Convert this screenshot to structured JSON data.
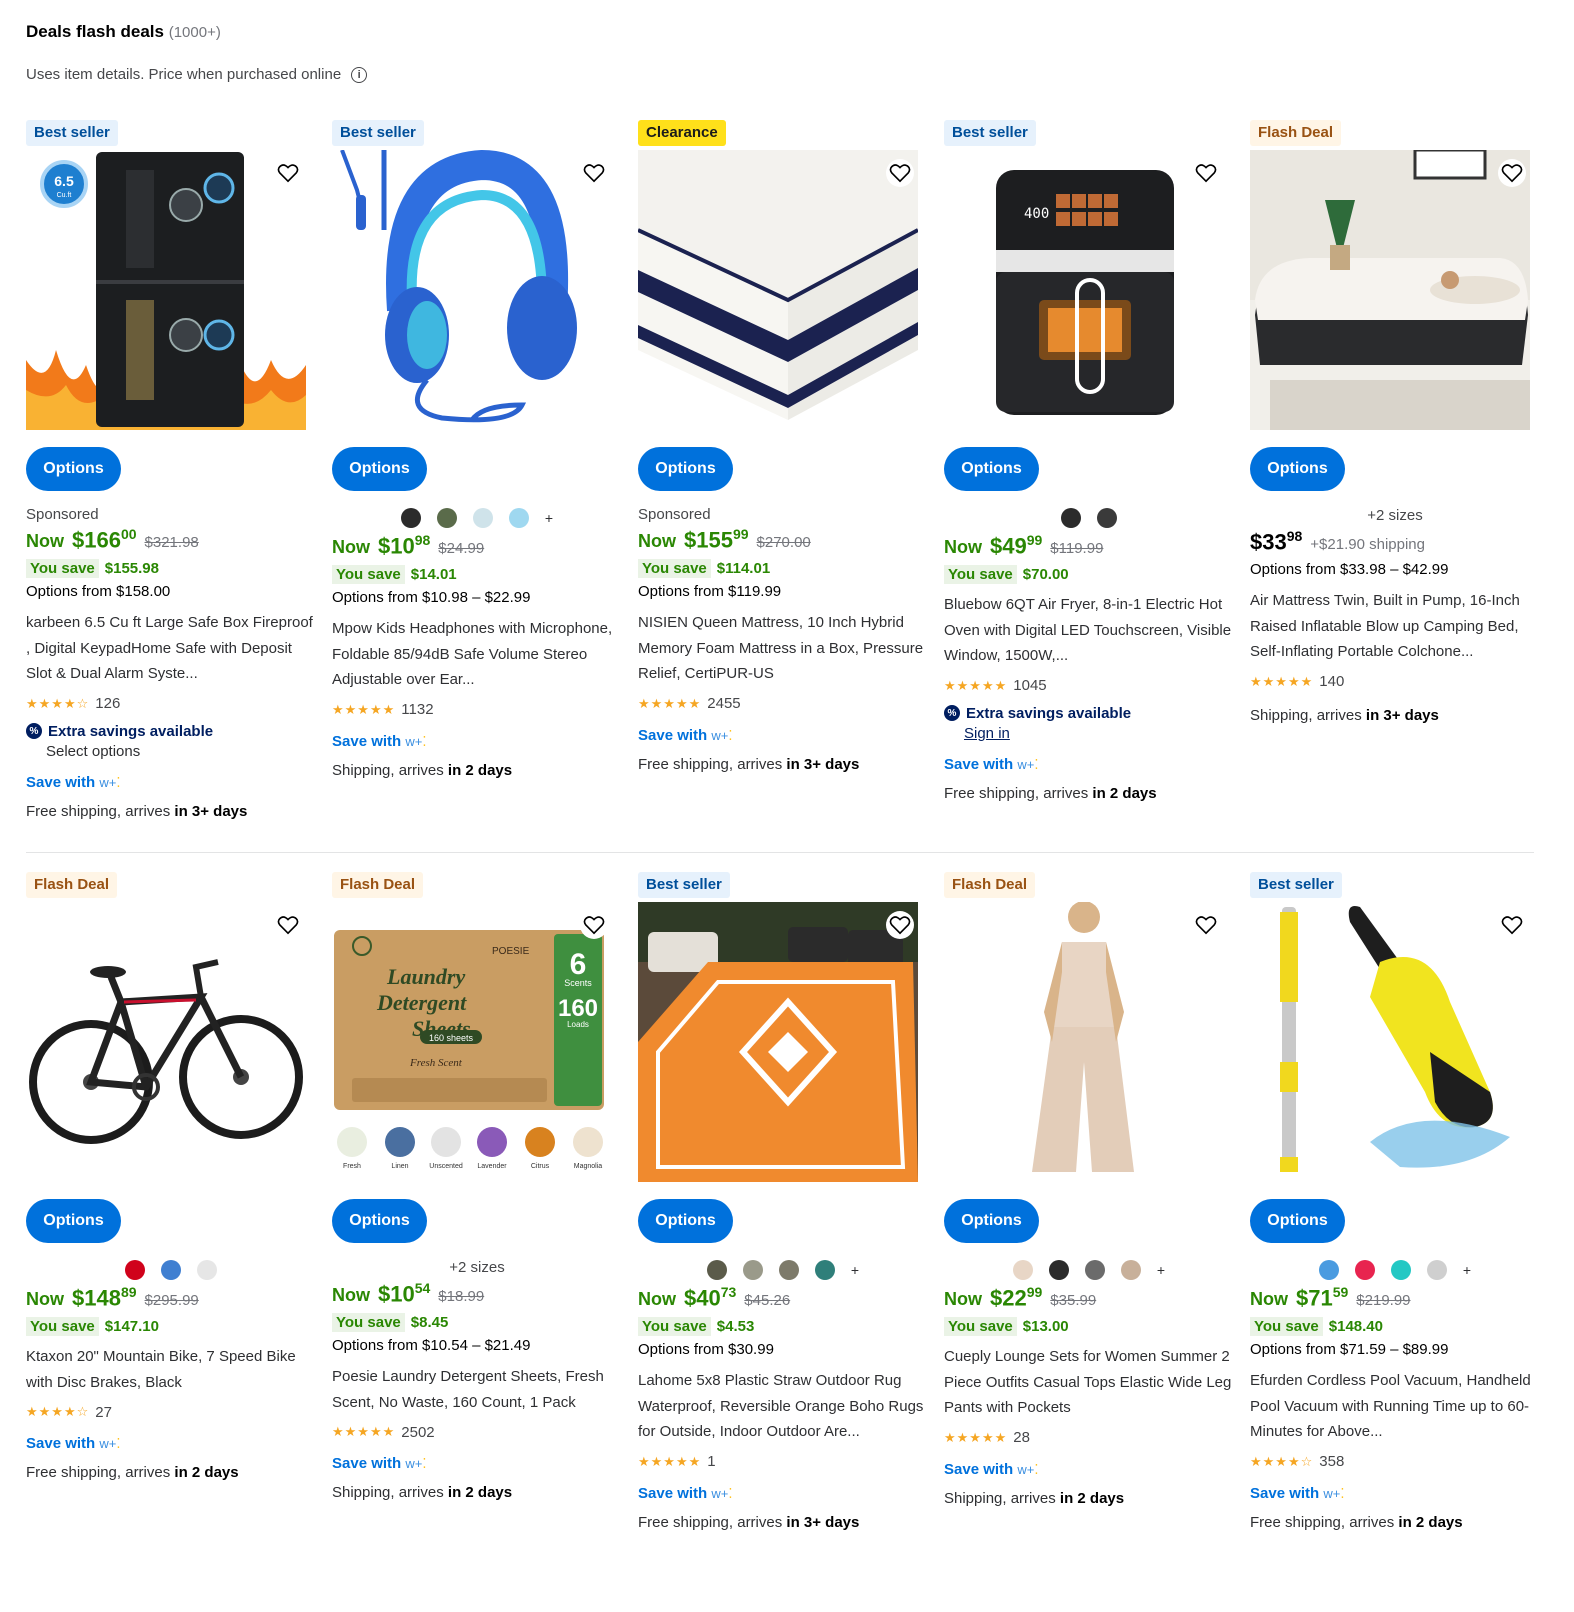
{
  "header": {
    "title": "Deals flash deals",
    "count": "(1000+)",
    "subtitle": "Uses item details. Price when purchased online"
  },
  "labels": {
    "options": "Options",
    "now": "Now",
    "you_save": "You save",
    "save_with": "Save with",
    "wplus": "w+",
    "extra_savings": "Extra savings available"
  },
  "products": [
    {
      "badge": "Best seller",
      "badge_type": "best",
      "sponsored": "Sponsored",
      "swatches": [],
      "swatch_more": "",
      "sizes": "",
      "price_prefix": "Now",
      "dollars": "$166",
      "cents": "00",
      "was": "$321.98",
      "you_save": "$155.98",
      "options_from": "Options from $158.00",
      "name": "karbeen 6.5 Cu ft Large Safe Box Fireproof , Digital KeypadHome Safe with Deposit Slot & Dual Alarm Syste...",
      "stars": "★★★★☆",
      "rating": 3.5,
      "reviews": "126",
      "extra_savings": true,
      "extra_sub": "Select options",
      "extra_sub_link": false,
      "ship_prefix": "Free shipping, arrives ",
      "ship_bold": "in 3+ days",
      "image": "safe"
    },
    {
      "badge": "Best seller",
      "badge_type": "best",
      "sponsored": "",
      "swatches": [
        "#2b2b2b",
        "#5a6b4a",
        "#cfe3ea",
        "#9fd8f0"
      ],
      "swatch_more": "+",
      "sizes": "",
      "price_prefix": "Now",
      "dollars": "$10",
      "cents": "98",
      "was": "$24.99",
      "you_save": "$14.01",
      "options_from": "Options from $10.98 – $22.99",
      "name": "Mpow Kids Headphones with Microphone, Foldable 85/94dB Safe Volume Stereo Adjustable over Ear...",
      "stars": "★★★★★",
      "rating": 4.5,
      "reviews": "1132",
      "extra_savings": false,
      "extra_sub": "",
      "extra_sub_link": false,
      "ship_prefix": "Shipping, arrives ",
      "ship_bold": "in 2 days",
      "image": "headphones"
    },
    {
      "badge": "Clearance",
      "badge_type": "clear",
      "sponsored": "Sponsored",
      "swatches": [],
      "swatch_more": "",
      "sizes": "",
      "price_prefix": "Now",
      "dollars": "$155",
      "cents": "99",
      "was": "$270.00",
      "you_save": "$114.01",
      "options_from": "Options from $119.99",
      "name": "NISIEN Queen Mattress, 10 Inch Hybrid Memory Foam Mattress in a Box, Pressure Relief, CertiPUR-US",
      "stars": "★★★★★",
      "rating": 4.5,
      "reviews": "2455",
      "extra_savings": false,
      "extra_sub": "",
      "extra_sub_link": false,
      "ship_prefix": "Free shipping, arrives ",
      "ship_bold": "in 3+ days",
      "image": "mattress"
    },
    {
      "badge": "Best seller",
      "badge_type": "best",
      "sponsored": "",
      "swatches": [
        "#2b2b2b",
        "#3a3a3a"
      ],
      "swatch_more": "",
      "sizes": "",
      "price_prefix": "Now",
      "dollars": "$49",
      "cents": "99",
      "was": "$119.99",
      "you_save": "$70.00",
      "options_from": "",
      "name": "Bluebow 6QT Air Fryer, 8-in-1 Electric Hot Oven with Digital LED Touchscreen, Visible Window, 1500W,...",
      "stars": "★★★★★",
      "rating": 4.5,
      "reviews": "1045",
      "extra_savings": true,
      "extra_sub": "Sign in",
      "extra_sub_link": true,
      "ship_prefix": "Free shipping, arrives ",
      "ship_bold": "in 2 days",
      "image": "airfryer"
    },
    {
      "badge": "Flash Deal",
      "badge_type": "flash",
      "sponsored": "",
      "swatches": [],
      "swatch_more": "",
      "sizes": "+2 sizes",
      "price_prefix": "",
      "dollars": "$33",
      "cents": "98",
      "was": "",
      "ship_extra": "+$21.90 shipping",
      "you_save": "",
      "options_from": "Options from $33.98 – $42.99",
      "name": "Air Mattress Twin, Built in Pump, 16-Inch Raised Inflatable Blow up Camping Bed, Self-Inflating Portable Colchone...",
      "stars": "★★★★★",
      "rating": 4.5,
      "reviews": "140",
      "extra_savings": false,
      "extra_sub": "",
      "extra_sub_link": false,
      "no_wplus": true,
      "ship_prefix": "Shipping, arrives ",
      "ship_bold": "in 3+ days",
      "image": "airbed"
    },
    {
      "badge": "Flash Deal",
      "badge_type": "flash",
      "sponsored": "",
      "swatches": [
        "#d0021b",
        "#3f7fd1",
        "#e6e6e6"
      ],
      "swatch_more": "",
      "sizes": "",
      "price_prefix": "Now",
      "dollars": "$148",
      "cents": "89",
      "was": "$295.99",
      "you_save": "$147.10",
      "options_from": "",
      "name": "Ktaxon 20\" Mountain Bike, 7 Speed Bike with Disc Brakes, Black",
      "stars": "★★★★☆",
      "rating": 4,
      "reviews": "27",
      "extra_savings": false,
      "extra_sub": "",
      "extra_sub_link": false,
      "ship_prefix": "Free shipping, arrives ",
      "ship_bold": "in 2 days",
      "image": "bike"
    },
    {
      "badge": "Flash Deal",
      "badge_type": "flash",
      "sponsored": "",
      "swatches": [],
      "swatch_more": "",
      "sizes": "+2 sizes",
      "price_prefix": "Now",
      "dollars": "$10",
      "cents": "54",
      "was": "$18.99",
      "you_save": "$8.45",
      "options_from": "Options from $10.54 – $21.49",
      "name": "Poesie Laundry Detergent Sheets, Fresh Scent, No Waste, 160 Count, 1 Pack",
      "stars": "★★★★★",
      "rating": 4.5,
      "reviews": "2502",
      "extra_savings": false,
      "extra_sub": "",
      "extra_sub_link": false,
      "ship_prefix": "Shipping, arrives ",
      "ship_bold": "in 2 days",
      "image": "laundry",
      "image_text": {
        "brand": "POESIE",
        "line1": "Laundry",
        "line2": "Detergent",
        "line3": "Sheets",
        "count": "160 sheets",
        "scent": "Fresh Scent",
        "badge_num": "6",
        "badge_scents": "Scents",
        "badge_count": "160",
        "badge_loads": "Loads",
        "variants": [
          "Fresh",
          "Linen",
          "Unscented",
          "Lavender",
          "Citrus",
          "Magnolia"
        ]
      }
    },
    {
      "badge": "Best seller",
      "badge_type": "best",
      "sponsored": "",
      "swatches": [
        "#5b5b4a",
        "#9a9a8a",
        "#7d7a6a",
        "#2f7f7a"
      ],
      "swatch_more": "+",
      "sizes": "",
      "price_prefix": "Now",
      "dollars": "$40",
      "cents": "73",
      "was": "$45.26",
      "you_save": "$4.53",
      "options_from": "Options from $30.99",
      "name": "Lahome 5x8 Plastic Straw Outdoor Rug Waterproof, Reversible Orange Boho Rugs for Outside, Indoor Outdoor Are...",
      "stars": "★★★★★",
      "rating": 5,
      "reviews": "1",
      "extra_savings": false,
      "extra_sub": "",
      "extra_sub_link": false,
      "no_wplus": true,
      "ship_prefix": "Free shipping, arrives ",
      "ship_bold": "in 3+ days",
      "image": "rug"
    },
    {
      "badge": "Flash Deal",
      "badge_type": "flash",
      "sponsored": "",
      "swatches": [
        "#e8d6c6",
        "#2b2b2b",
        "#6b6b6b",
        "#c8b09a"
      ],
      "swatch_more": "+",
      "sizes": "",
      "price_prefix": "Now",
      "dollars": "$22",
      "cents": "99",
      "was": "$35.99",
      "you_save": "$13.00",
      "options_from": "",
      "name": "Cueply Lounge Sets for Women Summer 2 Piece Outfits Casual Tops Elastic Wide Leg Pants with Pockets",
      "stars": "★★★★★",
      "rating": 4.5,
      "reviews": "28",
      "extra_savings": false,
      "extra_sub": "",
      "extra_sub_link": false,
      "ship_prefix": "Shipping, arrives ",
      "ship_bold": "in 2 days",
      "image": "outfit"
    },
    {
      "badge": "Best seller",
      "badge_type": "best",
      "sponsored": "",
      "swatches": [
        "#4a9be0",
        "#e8244f",
        "#23c8c4",
        "#cfcfcf"
      ],
      "swatch_more": "+",
      "sizes": "",
      "price_prefix": "Now",
      "dollars": "$71",
      "cents": "59",
      "was": "$219.99",
      "you_save": "$148.40",
      "options_from": "Options from $71.59 – $89.99",
      "name": "Efurden Cordless Pool Vacuum, Handheld Pool Vacuum with Running Time up to 60-Minutes for Above...",
      "stars": "★★★★☆",
      "rating": 4,
      "reviews": "358",
      "extra_savings": false,
      "extra_sub": "",
      "extra_sub_link": false,
      "ship_prefix": "Free shipping, arrives ",
      "ship_bold": "in 2 days",
      "image": "poolvac"
    }
  ],
  "image_texts": {
    "safe_badge": "6.5",
    "safe_badge_unit": "Cu.ft",
    "airfryer_display": "400"
  }
}
